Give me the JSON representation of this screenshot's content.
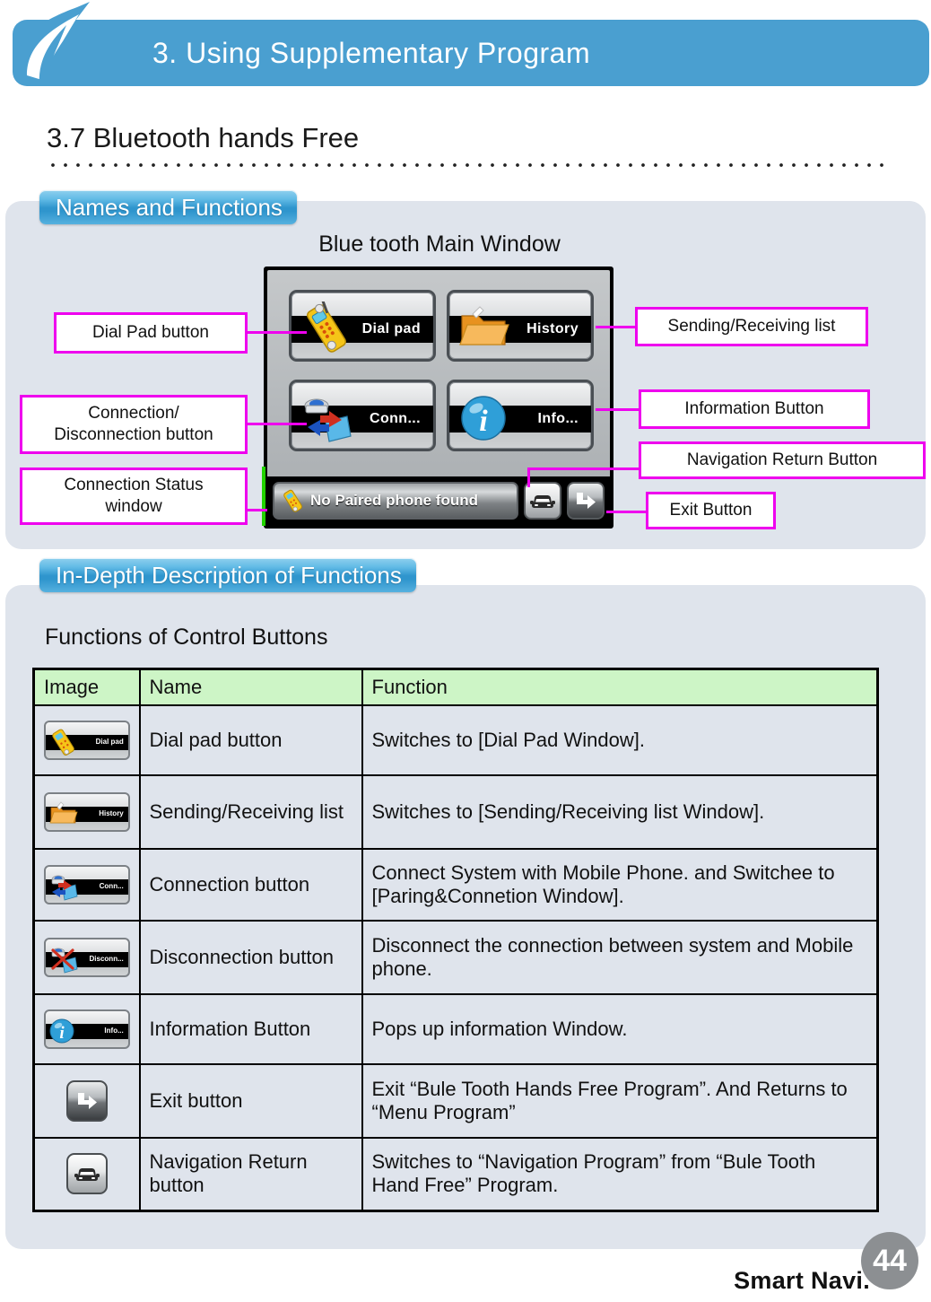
{
  "header": {
    "chapter_title": "3. Using Supplementary Program",
    "logo_name": "smart-navi-logo",
    "brand_blue": "#4a9fd0"
  },
  "section": {
    "number_and_title": "3.7 Bluetooth hands Free"
  },
  "panels": {
    "names_tab": "Names and Functions",
    "depth_tab": "In-Depth Description of Functions"
  },
  "device": {
    "caption": "Blue tooth Main Window",
    "buttons": [
      {
        "key": "dial",
        "label": "Dial pad",
        "icon": "yellow-phone-icon"
      },
      {
        "key": "history",
        "label": "History",
        "icon": "folder-icon"
      },
      {
        "key": "conn",
        "label": "Conn...",
        "icon": "connect-devices-icon"
      },
      {
        "key": "info",
        "label": "Info...",
        "icon": "info-ball-icon"
      }
    ],
    "status_text": "No Paired phone found",
    "status_icon": "yellow-phone-icon",
    "nav_return_icon": "car-front-icon",
    "exit_icon": "arrow-exit-icon"
  },
  "callouts": {
    "dial_pad": "Dial Pad button",
    "connection_disconnection": "Connection/\nDisconnection button",
    "connection_status": "Connection Status\nwindow",
    "sending_receiving": "Sending/Receiving list",
    "information": "Information Button",
    "navigation_return": "Navigation Return Button",
    "exit": "Exit Button",
    "line_color": "#ee00ee",
    "status_marker_color": "#22d400"
  },
  "table": {
    "caption": "Functions of Control Buttons",
    "headers": [
      "Image",
      "Name",
      "Function"
    ],
    "header_bg": "#cdf5c6",
    "rows": [
      {
        "thumb_kind": "strip",
        "thumb_label": "Dial pad",
        "thumb_icon": "yellow-phone-icon",
        "name": "Dial pad button",
        "function": "Switches to [Dial Pad Window]."
      },
      {
        "thumb_kind": "strip",
        "thumb_label": "History",
        "thumb_icon": "folder-icon",
        "name": "Sending/Receiving list",
        "function": "Switches to [Sending/Receiving list Window]."
      },
      {
        "thumb_kind": "strip",
        "thumb_label": "Conn...",
        "thumb_icon": "connect-devices-icon",
        "name": "Connection button",
        "function": "Connect System with Mobile Phone. and Switchee to [Paring&Connetion Window]."
      },
      {
        "thumb_kind": "strip",
        "thumb_label": "Disconn...",
        "thumb_icon": "disconnect-devices-icon",
        "name": "Disconnection button",
        "function": "Disconnect the connection between system and Mobile phone."
      },
      {
        "thumb_kind": "strip",
        "thumb_label": "Info...",
        "thumb_icon": "info-ball-icon",
        "name": "Information Button",
        "function": "Pops up information Window."
      },
      {
        "thumb_kind": "square-dark",
        "thumb_label": "",
        "thumb_icon": "arrow-exit-icon",
        "name": "Exit button",
        "function": "Exit “Bule Tooth Hands Free Program”. And Returns to “Menu Program”"
      },
      {
        "thumb_kind": "square-light",
        "thumb_label": "",
        "thumb_icon": "car-front-icon",
        "name": "Navigation Return button",
        "function": "Switches to “Navigation Program” from “Bule Tooth Hand Free” Program."
      }
    ]
  },
  "footer": {
    "brand": "Smart Navi.",
    "page_number": "44"
  }
}
